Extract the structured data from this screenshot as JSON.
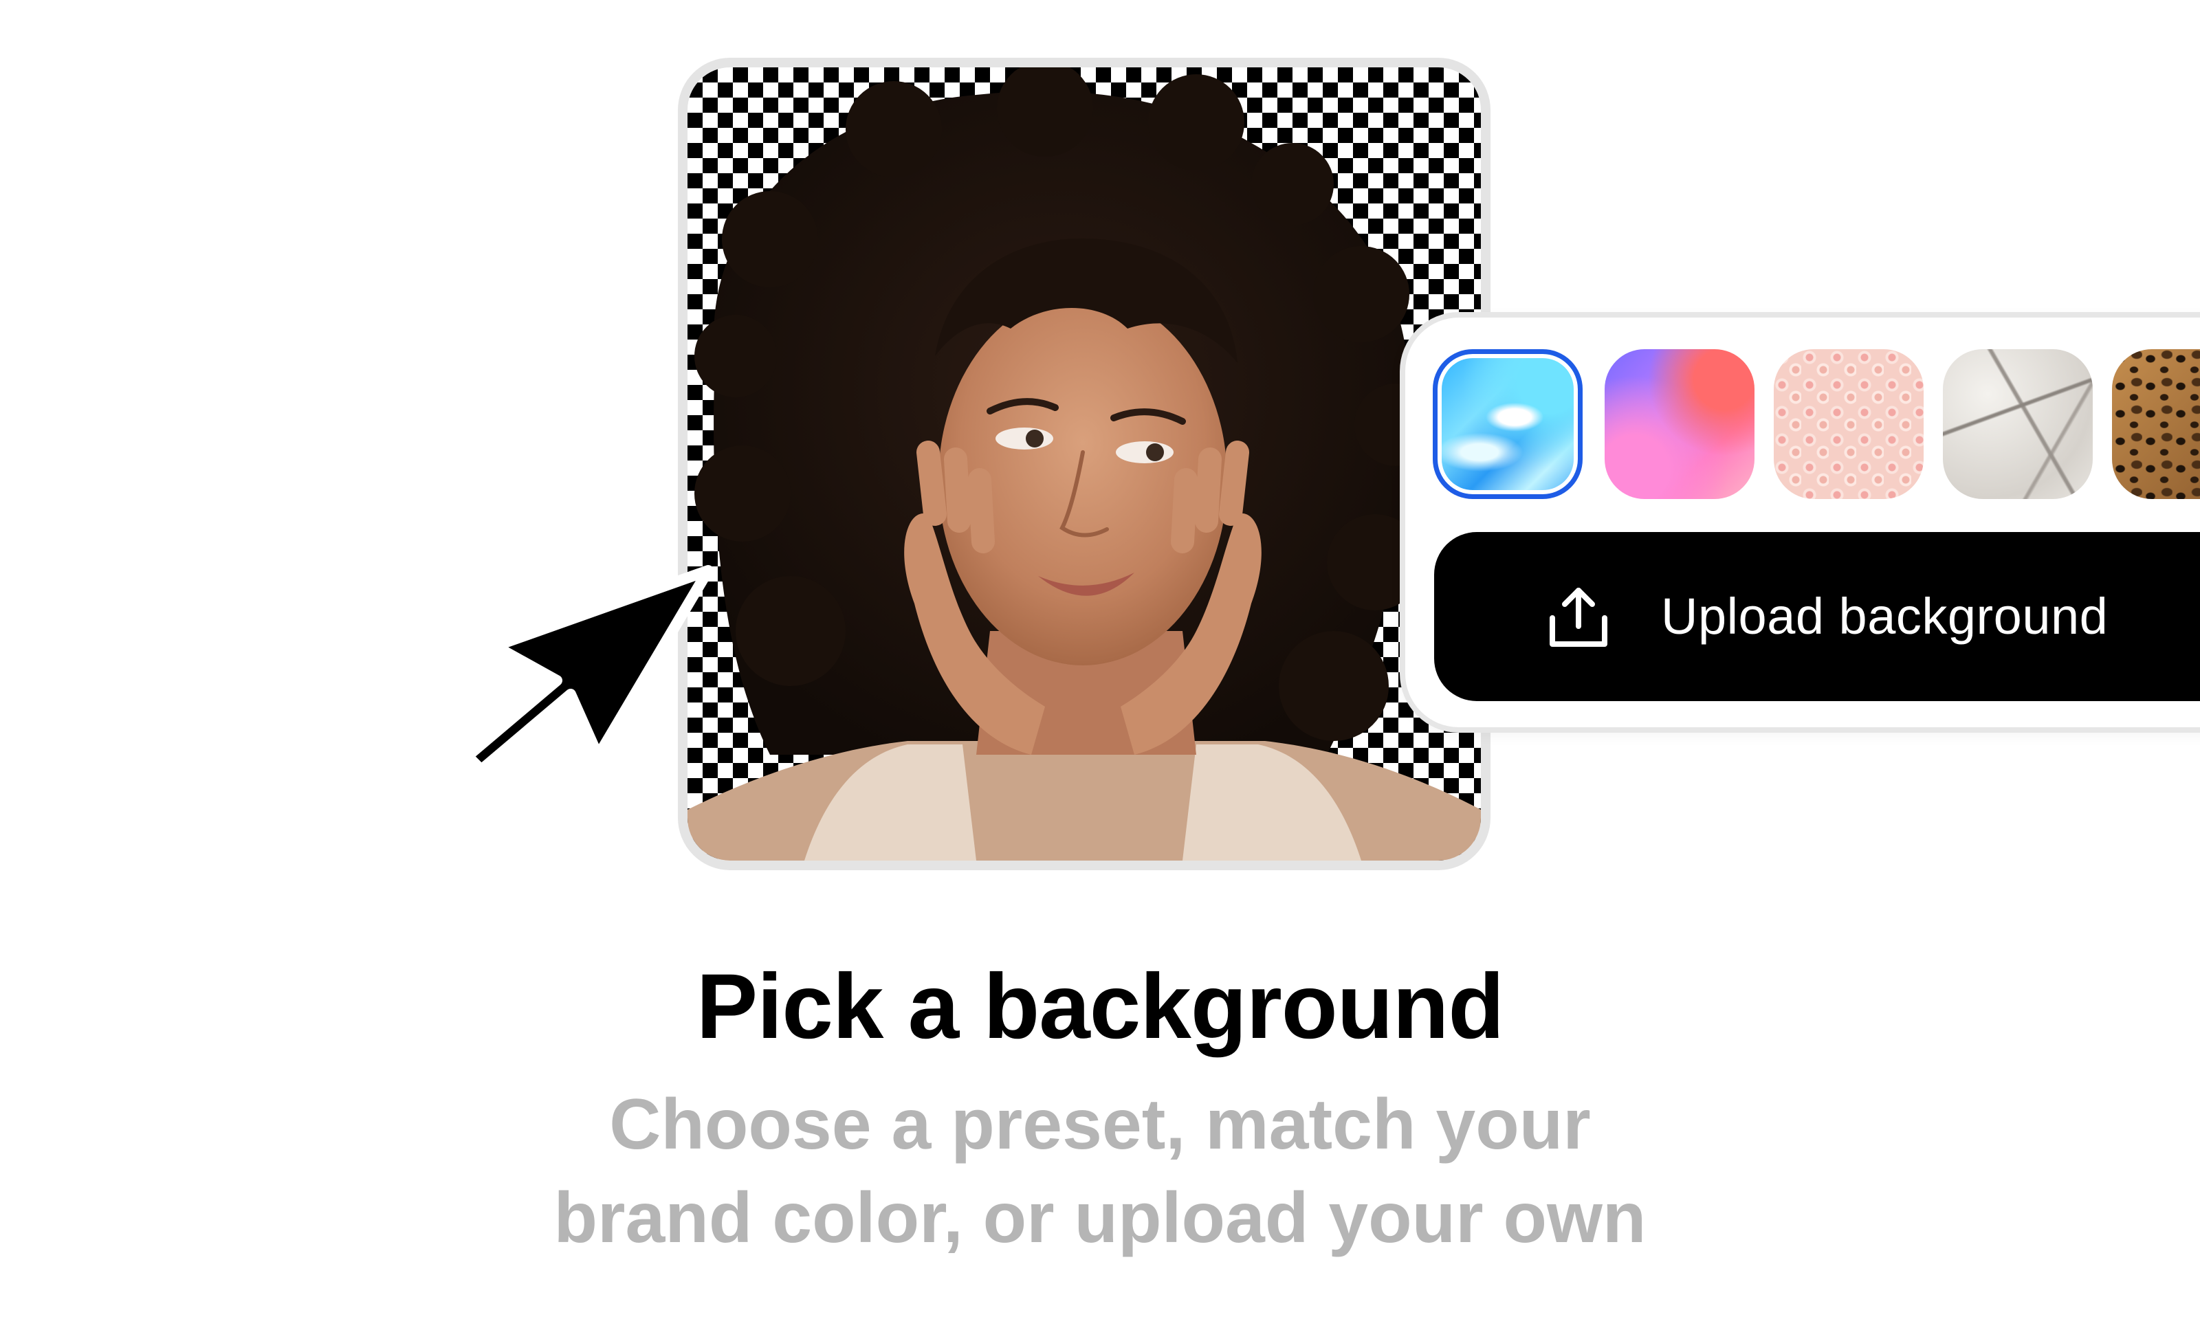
{
  "feature": {
    "title": "Pick a background",
    "subtitle_line1": "Choose a preset, match your",
    "subtitle_line2": "brand color, or upload your own"
  },
  "picker": {
    "swatches": [
      {
        "name": "blue-liquid-preset",
        "selected": true
      },
      {
        "name": "pink-purple-gradient-preset",
        "selected": false
      },
      {
        "name": "peach-floral-preset",
        "selected": false
      },
      {
        "name": "cracked-marble-preset",
        "selected": false
      },
      {
        "name": "leopard-print-preset",
        "selected": false
      }
    ],
    "upload_label": "Upload background",
    "upload_icon": "upload-icon"
  },
  "colors": {
    "selection": "#1e5ce6",
    "button_bg": "#000000",
    "subtitle": "#b5b5b5"
  }
}
